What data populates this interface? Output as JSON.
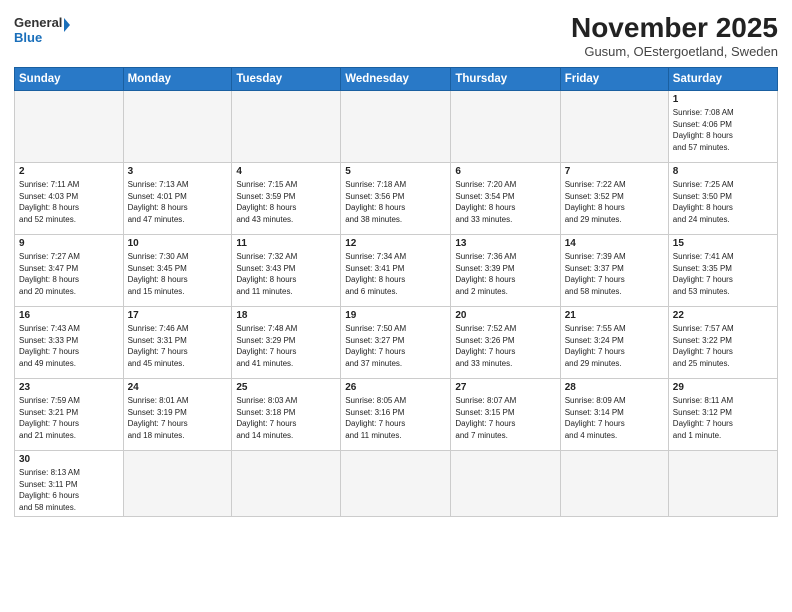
{
  "header": {
    "logo_line1": "General",
    "logo_line2": "Blue",
    "month": "November 2025",
    "location": "Gusum, OEstergoetland, Sweden"
  },
  "weekdays": [
    "Sunday",
    "Monday",
    "Tuesday",
    "Wednesday",
    "Thursday",
    "Friday",
    "Saturday"
  ],
  "weeks": [
    [
      {
        "day": "",
        "info": ""
      },
      {
        "day": "",
        "info": ""
      },
      {
        "day": "",
        "info": ""
      },
      {
        "day": "",
        "info": ""
      },
      {
        "day": "",
        "info": ""
      },
      {
        "day": "",
        "info": ""
      },
      {
        "day": "1",
        "info": "Sunrise: 7:08 AM\nSunset: 4:06 PM\nDaylight: 8 hours\nand 57 minutes."
      }
    ],
    [
      {
        "day": "2",
        "info": "Sunrise: 7:11 AM\nSunset: 4:03 PM\nDaylight: 8 hours\nand 52 minutes."
      },
      {
        "day": "3",
        "info": "Sunrise: 7:13 AM\nSunset: 4:01 PM\nDaylight: 8 hours\nand 47 minutes."
      },
      {
        "day": "4",
        "info": "Sunrise: 7:15 AM\nSunset: 3:59 PM\nDaylight: 8 hours\nand 43 minutes."
      },
      {
        "day": "5",
        "info": "Sunrise: 7:18 AM\nSunset: 3:56 PM\nDaylight: 8 hours\nand 38 minutes."
      },
      {
        "day": "6",
        "info": "Sunrise: 7:20 AM\nSunset: 3:54 PM\nDaylight: 8 hours\nand 33 minutes."
      },
      {
        "day": "7",
        "info": "Sunrise: 7:22 AM\nSunset: 3:52 PM\nDaylight: 8 hours\nand 29 minutes."
      },
      {
        "day": "8",
        "info": "Sunrise: 7:25 AM\nSunset: 3:50 PM\nDaylight: 8 hours\nand 24 minutes."
      }
    ],
    [
      {
        "day": "9",
        "info": "Sunrise: 7:27 AM\nSunset: 3:47 PM\nDaylight: 8 hours\nand 20 minutes."
      },
      {
        "day": "10",
        "info": "Sunrise: 7:30 AM\nSunset: 3:45 PM\nDaylight: 8 hours\nand 15 minutes."
      },
      {
        "day": "11",
        "info": "Sunrise: 7:32 AM\nSunset: 3:43 PM\nDaylight: 8 hours\nand 11 minutes."
      },
      {
        "day": "12",
        "info": "Sunrise: 7:34 AM\nSunset: 3:41 PM\nDaylight: 8 hours\nand 6 minutes."
      },
      {
        "day": "13",
        "info": "Sunrise: 7:36 AM\nSunset: 3:39 PM\nDaylight: 8 hours\nand 2 minutes."
      },
      {
        "day": "14",
        "info": "Sunrise: 7:39 AM\nSunset: 3:37 PM\nDaylight: 7 hours\nand 58 minutes."
      },
      {
        "day": "15",
        "info": "Sunrise: 7:41 AM\nSunset: 3:35 PM\nDaylight: 7 hours\nand 53 minutes."
      }
    ],
    [
      {
        "day": "16",
        "info": "Sunrise: 7:43 AM\nSunset: 3:33 PM\nDaylight: 7 hours\nand 49 minutes."
      },
      {
        "day": "17",
        "info": "Sunrise: 7:46 AM\nSunset: 3:31 PM\nDaylight: 7 hours\nand 45 minutes."
      },
      {
        "day": "18",
        "info": "Sunrise: 7:48 AM\nSunset: 3:29 PM\nDaylight: 7 hours\nand 41 minutes."
      },
      {
        "day": "19",
        "info": "Sunrise: 7:50 AM\nSunset: 3:27 PM\nDaylight: 7 hours\nand 37 minutes."
      },
      {
        "day": "20",
        "info": "Sunrise: 7:52 AM\nSunset: 3:26 PM\nDaylight: 7 hours\nand 33 minutes."
      },
      {
        "day": "21",
        "info": "Sunrise: 7:55 AM\nSunset: 3:24 PM\nDaylight: 7 hours\nand 29 minutes."
      },
      {
        "day": "22",
        "info": "Sunrise: 7:57 AM\nSunset: 3:22 PM\nDaylight: 7 hours\nand 25 minutes."
      }
    ],
    [
      {
        "day": "23",
        "info": "Sunrise: 7:59 AM\nSunset: 3:21 PM\nDaylight: 7 hours\nand 21 minutes."
      },
      {
        "day": "24",
        "info": "Sunrise: 8:01 AM\nSunset: 3:19 PM\nDaylight: 7 hours\nand 18 minutes."
      },
      {
        "day": "25",
        "info": "Sunrise: 8:03 AM\nSunset: 3:18 PM\nDaylight: 7 hours\nand 14 minutes."
      },
      {
        "day": "26",
        "info": "Sunrise: 8:05 AM\nSunset: 3:16 PM\nDaylight: 7 hours\nand 11 minutes."
      },
      {
        "day": "27",
        "info": "Sunrise: 8:07 AM\nSunset: 3:15 PM\nDaylight: 7 hours\nand 7 minutes."
      },
      {
        "day": "28",
        "info": "Sunrise: 8:09 AM\nSunset: 3:14 PM\nDaylight: 7 hours\nand 4 minutes."
      },
      {
        "day": "29",
        "info": "Sunrise: 8:11 AM\nSunset: 3:12 PM\nDaylight: 7 hours\nand 1 minute."
      }
    ],
    [
      {
        "day": "30",
        "info": "Sunrise: 8:13 AM\nSunset: 3:11 PM\nDaylight: 6 hours\nand 58 minutes."
      },
      {
        "day": "",
        "info": ""
      },
      {
        "day": "",
        "info": ""
      },
      {
        "day": "",
        "info": ""
      },
      {
        "day": "",
        "info": ""
      },
      {
        "day": "",
        "info": ""
      },
      {
        "day": "",
        "info": ""
      }
    ]
  ]
}
